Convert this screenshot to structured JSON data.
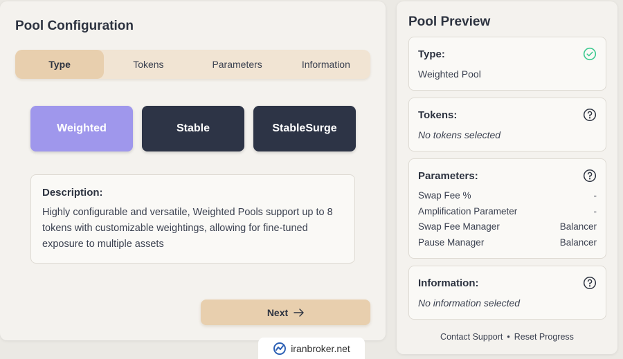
{
  "config": {
    "title": "Pool Configuration",
    "tabs": [
      {
        "label": "Type",
        "active": true
      },
      {
        "label": "Tokens",
        "active": false
      },
      {
        "label": "Parameters",
        "active": false
      },
      {
        "label": "Information",
        "active": false
      }
    ],
    "pool_types": [
      {
        "label": "Weighted",
        "selected": true
      },
      {
        "label": "Stable",
        "selected": false
      },
      {
        "label": "StableSurge",
        "selected": false
      }
    ],
    "description": {
      "heading": "Description:",
      "text": "Highly configurable and versatile, Weighted Pools support up to 8 tokens with customizable weightings, allowing for fine-tuned exposure to multiple assets"
    },
    "next_label": "Next",
    "next_icon": "arrow-right-icon"
  },
  "preview": {
    "title": "Pool Preview",
    "type": {
      "heading": "Type:",
      "value": "Weighted Pool",
      "icon": "check-circle-icon"
    },
    "tokens": {
      "heading": "Tokens:",
      "value": "No tokens selected",
      "icon": "question-circle-icon"
    },
    "parameters": {
      "heading": "Parameters:",
      "icon": "question-circle-icon",
      "rows": [
        {
          "label": "Swap Fee %",
          "value": "-"
        },
        {
          "label": "Amplification Parameter",
          "value": "-"
        },
        {
          "label": "Swap Fee Manager",
          "value": "Balancer"
        },
        {
          "label": "Pause Manager",
          "value": "Balancer"
        }
      ]
    },
    "information": {
      "heading": "Information:",
      "value": "No information selected",
      "icon": "question-circle-icon"
    },
    "footer": {
      "contact": "Contact Support",
      "separator": "•",
      "reset": "Reset Progress"
    }
  },
  "watermark": {
    "text": "iranbroker.net"
  },
  "colors": {
    "accent_tan": "#e8cfae",
    "selected_purple": "#9f97ec",
    "dark_button": "#2d3446",
    "check_green": "#3cc98f"
  }
}
